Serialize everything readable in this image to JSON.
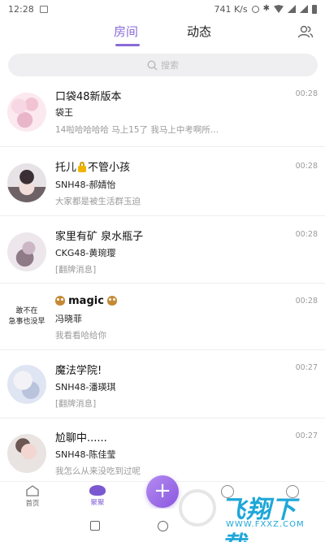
{
  "status_bar": {
    "time": "12:28",
    "network_speed": "741 K/s"
  },
  "header": {
    "tabs": [
      {
        "label": "房间",
        "active": true
      },
      {
        "label": "动态",
        "active": false
      }
    ],
    "accent_color": "#8a6bd8"
  },
  "search": {
    "placeholder": "搜索"
  },
  "rooms": [
    {
      "name": "口袋48新版本",
      "time": "00:28",
      "sender": "袋王",
      "preview": "14啦哈哈哈哈 马上15了 我马上中考啊所..."
    },
    {
      "name_before_icon": "托儿",
      "name_after_icon": "不管小孩",
      "icon": "lock-icon",
      "time": "00:28",
      "sender": "SNH48-郝婧怡",
      "preview": "大家都是被生活群玉迫"
    },
    {
      "name": "家里有矿 泉水瓶子",
      "time": "00:28",
      "sender": "CKG48-黄琬璎",
      "preview": "[翻牌消息]"
    },
    {
      "name": "magic",
      "icon": "owl-icon",
      "time": "00:28",
      "sender": "冯晓菲",
      "preview": "我看看哈给你",
      "avatar_text": [
        "敢不在",
        "急事也没早"
      ]
    },
    {
      "name": "魔法学院!",
      "time": "00:27",
      "sender": "SNH48-潘瑛琪",
      "preview": "[翻牌消息]"
    },
    {
      "name": "尬聊中......",
      "time": "00:27",
      "sender": "SNH48-陈佳莹",
      "preview": "我怎么从来没吃到过呢"
    }
  ],
  "bottom_nav": {
    "home_label": "首页",
    "idol_label": "聚聚",
    "add_label": "+"
  },
  "watermark": {
    "brand": "飞翔下载",
    "url": "WWW.FXXZ.COM"
  }
}
